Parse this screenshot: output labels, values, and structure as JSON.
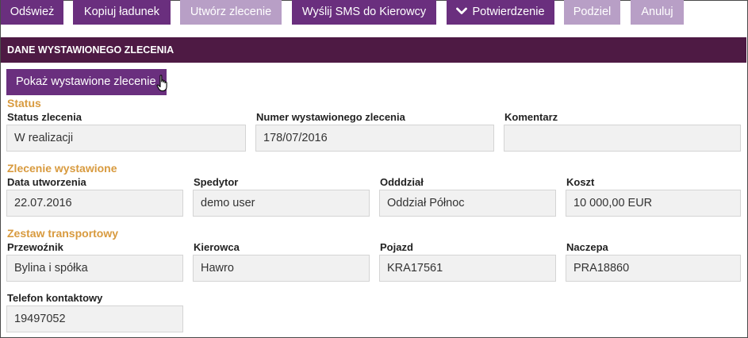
{
  "toolbar": {
    "refresh": "Odśwież",
    "copy_load": "Kopiuj ładunek",
    "create_order": "Utwórz zlecenie",
    "send_sms": "Wyślij SMS do Kierowcy",
    "confirmation": "Potwierdzenie",
    "split": "Podziel",
    "cancel": "Anuluj"
  },
  "section": {
    "title": "DANE WYSTAWIONEGO ZLECENIA",
    "show_button": "Pokaż wystawione zlecenie"
  },
  "status": {
    "title": "Status",
    "order_status_label": "Status zlecenia",
    "order_status_value": "W realizacji",
    "order_number_label": "Numer wystawionego zlecenia",
    "order_number_value": "178/07/2016",
    "comment_label": "Komentarz",
    "comment_value": ""
  },
  "issued": {
    "title": "Zlecenie wystawione",
    "created_label": "Data utworzenia",
    "created_value": "22.07.2016",
    "forwarder_label": "Spedytor",
    "forwarder_value": "demo user",
    "branch_label": "Odddział",
    "branch_value": "Oddział Północ",
    "cost_label": "Koszt",
    "cost_value": "10 000,00 EUR"
  },
  "transport": {
    "title": "Zestaw transportowy",
    "carrier_label": "Przewoźnik",
    "carrier_value": "Bylina i spółka",
    "driver_label": "Kierowca",
    "driver_value": "Hawro",
    "vehicle_label": "Pojazd",
    "vehicle_value": "KRA17561",
    "trailer_label": "Naczepa",
    "trailer_value": "PRA18860",
    "phone_label": "Telefon kontaktowy",
    "phone_value": "19497052"
  },
  "icons": {
    "confirmation_chevron": "chevron-down-icon",
    "cursor": "hand-pointer-icon"
  },
  "colors": {
    "button_active": "#6a2f7e",
    "button_disabled": "#b89fc6",
    "section_header": "#4e1a44",
    "group_title": "#d89a3e",
    "field_background": "#f1f1f1"
  }
}
